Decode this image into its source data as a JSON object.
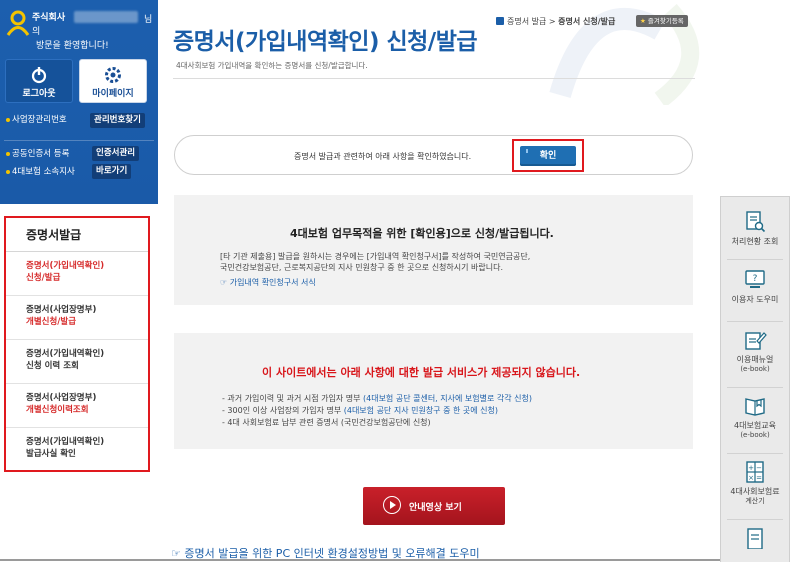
{
  "user_panel": {
    "greet_company": "주식회사",
    "greet_suffix": "님",
    "greet_ui": "의",
    "greet_welcome": "방문을 환영합니다!",
    "logout_label": "로그아웃",
    "mypage_label": "마이페이지",
    "biz_no_label": "사업장관리번호",
    "biz_no_button": "관리번호찾기",
    "cert_label": "공동인증서 등록",
    "cert_button": "인증서관리",
    "branch_label": "4대보험 소속지사",
    "branch_button": "바로가기"
  },
  "side_menu": {
    "title": "증명서발급",
    "items": [
      {
        "line1": "증명서(가입내역확인)",
        "line2": "신청/발급"
      },
      {
        "line1": "증명서(사업장명부)",
        "line2": "개별신청/발급"
      },
      {
        "line1": "증명서(가입내역확인)",
        "line2": "신청 이력 조회"
      },
      {
        "line1": "증명서(사업장명부)",
        "line2": "개별신청이력조회"
      },
      {
        "line1": "증명서(가입내역확인)",
        "line2": "발급사실 확인"
      }
    ]
  },
  "header": {
    "title": "증명서(가입내역확인) 신청/발급",
    "subtitle": "4대사회보험 가입내역을 확인하는 증명서를 신청/발급합니다.",
    "breadcrumb_parent": "증명서 발급",
    "breadcrumb_sep": ">",
    "breadcrumb_current": "증명서 신청/발급",
    "favorite_label": "즐겨찾기등록"
  },
  "confirm": {
    "text": "증명서 발급과 관련하여 아래 사항을 확인하였습니다.",
    "button": "확인"
  },
  "notice1": {
    "heading": "4대보험 업무목적을 위한 [확인용]으로 신청/발급됩니다.",
    "body_line1": "[타 기관 제출용] 발급을 원하시는 경우에는 [가입내역 확인청구서]를 작성하여 국민연금공단,",
    "body_line2": "국민건강보험공단, 근로복지공단의 지사 민원창구 중 한 곳으로 신청하시기 바랍니다.",
    "link": "☞ 가입내역 확인청구서 서식"
  },
  "notice2": {
    "heading": "이 사이트에서는 아래 사항에 대한 발급 서비스가 제공되지 않습니다.",
    "items": [
      {
        "text": "- 과거 가입이력 및 과거 시점 가입자 명부 ",
        "note": "(4대보험 공단 콜센터, 지사에 보험별로 각각 신청)"
      },
      {
        "text": "- 300인 이상 사업장의 가입자 명부 ",
        "note": "(4대보험 공단 지사 민원창구 중 한 곳에 신청)"
      },
      {
        "text": "- 4대 사회보험료 납부 관련 증명서 (국민건강보험공단에 신청)",
        "note": ""
      }
    ]
  },
  "video_button": "안내영상 보기",
  "bottom_link": "☞ 증명서 발급을 위한 PC 인터넷 환경설정방법 및 오류해결 도우미",
  "quick_menu": [
    {
      "label": "처리현황 조회",
      "sub": "",
      "icon": "document-search-icon"
    },
    {
      "label": "이용자 도우미",
      "sub": "",
      "icon": "monitor-help-icon"
    },
    {
      "label": "이용매뉴얼",
      "sub": "(e-book)",
      "icon": "manual-edit-icon"
    },
    {
      "label": "4대보험교육",
      "sub": "(e-book)",
      "icon": "book-icon"
    },
    {
      "label": "4대사회보험료",
      "sub": "계산기",
      "icon": "calculator-icon"
    }
  ],
  "colors": {
    "brand_blue": "#1b5ea8",
    "highlight_red": "#e0191e",
    "video_red": "#b81a24"
  }
}
